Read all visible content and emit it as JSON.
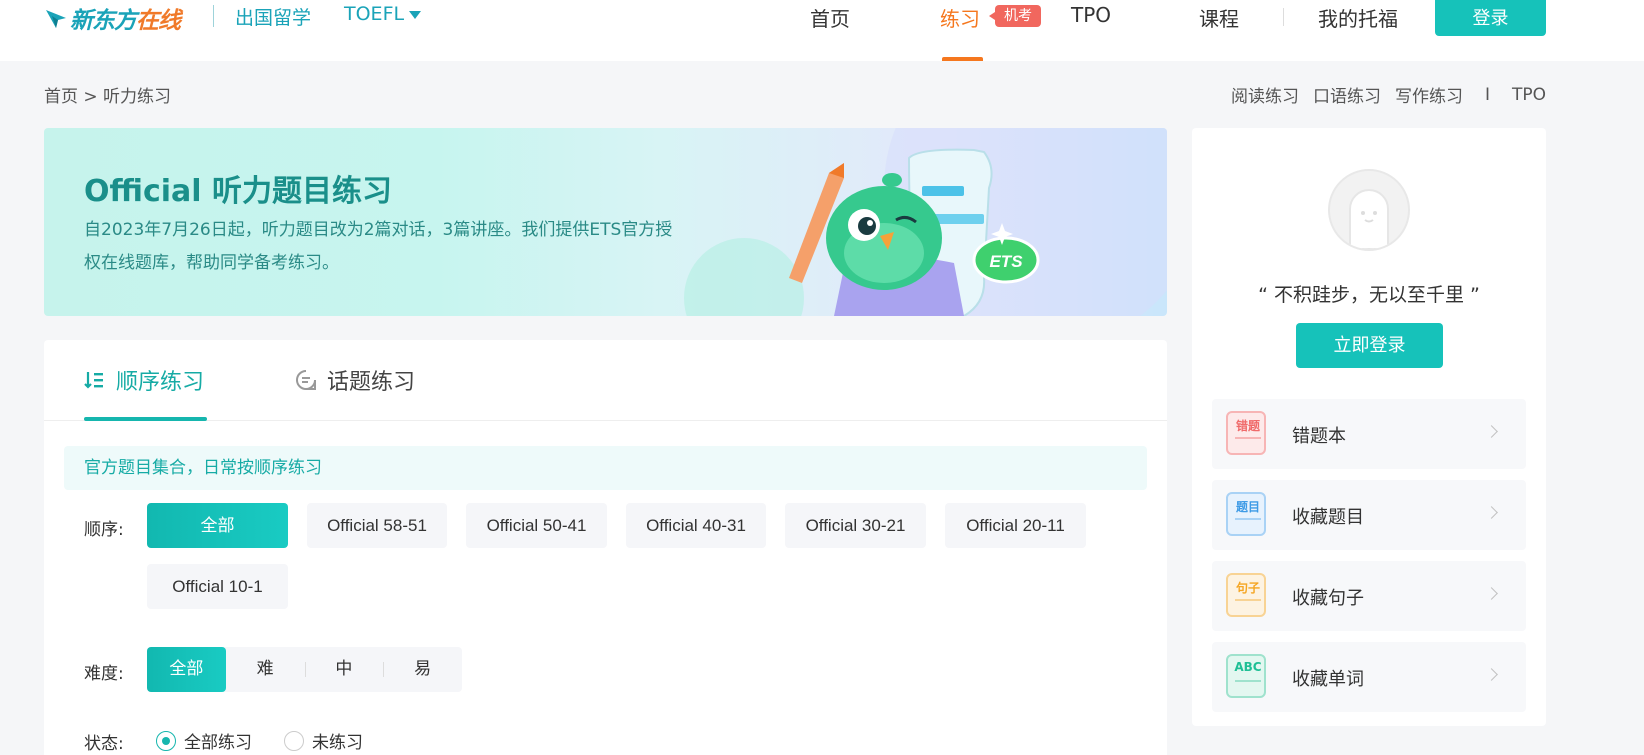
{
  "header": {
    "logo_text_a": "新东方",
    "logo_text_b": "在线",
    "brand_sub": "出国留学",
    "exam": "TOEFL",
    "nav": [
      {
        "label": "首页"
      },
      {
        "label": "练习",
        "active": true
      },
      {
        "label": "TPO"
      },
      {
        "label": "课程"
      },
      {
        "label": "我的托福"
      }
    ],
    "badge": "机考",
    "login_label": "登录",
    "accent_color": "#16c2ba",
    "active_color": "#f5771e"
  },
  "breadcrumb": "首页 > 听力练习",
  "quick_links": [
    "阅读练习",
    "口语练习",
    "写作练习",
    "TPO"
  ],
  "quick_links_sep": "I",
  "banner": {
    "title": "Official 听力题目练习",
    "desc": "自2023年7月26日起，听力题目改为2篇对话，3篇讲座。我们提供ETS官方授权在线题库，帮助同学备考练习。",
    "badge": "ETS"
  },
  "tabs": [
    {
      "label": "顺序练习",
      "icon": "list-order-icon",
      "active": true
    },
    {
      "label": "话题练习",
      "icon": "chat-topic-icon",
      "active": false
    }
  ],
  "tip": "官方题目集合，日常按顺序练习",
  "filters": {
    "order_label": "顺序:",
    "order_options": [
      "全部",
      "Official 58-51",
      "Official 50-41",
      "Official 40-31",
      "Official 30-21",
      "Official 20-11",
      "Official 10-1"
    ],
    "order_selected": "全部",
    "difficulty_label": "难度:",
    "difficulty_options": [
      "全部",
      "难",
      "中",
      "易"
    ],
    "difficulty_selected": "全部",
    "status_label": "状态:",
    "status_options": [
      "全部练习",
      "未练习"
    ],
    "status_selected": "全部练习"
  },
  "sidebar": {
    "quote": "“ 不积跬步，无以至千里 ”",
    "login_label": "立即登录",
    "items": [
      {
        "label": "错题本",
        "icon": "wrong-book-icon",
        "icon_text": "错题",
        "color": "#f06a6a"
      },
      {
        "label": "收藏题目",
        "icon": "favorite-question-icon",
        "icon_text": "题目",
        "color": "#3e9be6"
      },
      {
        "label": "收藏句子",
        "icon": "favorite-sentence-icon",
        "icon_text": "句子",
        "color": "#f5a623"
      },
      {
        "label": "收藏单词",
        "icon": "favorite-word-icon",
        "icon_text": "ABC",
        "color": "#1fbf95"
      }
    ]
  }
}
